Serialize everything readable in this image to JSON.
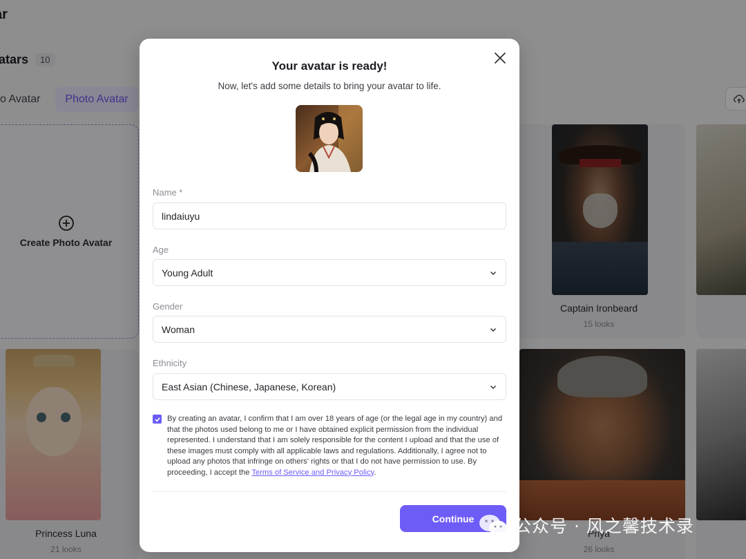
{
  "background": {
    "page_title": "ar",
    "section_heading": "vatars",
    "avatar_count": "10",
    "tabs": [
      {
        "label": "o Avatar",
        "active": false
      },
      {
        "label": "Photo Avatar",
        "active": true
      }
    ],
    "create_card_label": "Create Photo Avatar",
    "cards": [
      {
        "name": "Captain Ironbeard",
        "looks": "15 looks"
      },
      {
        "name": "Princess Luna",
        "looks": "21 looks"
      },
      {
        "name": "Priya",
        "looks": "26 looks"
      }
    ]
  },
  "modal": {
    "title": "Your avatar is ready!",
    "subtitle": "Now, let's add some details to bring your avatar to life.",
    "fields": {
      "name": {
        "label": "Name *",
        "value": "lindaiuyu"
      },
      "age": {
        "label": "Age",
        "value": "Young Adult"
      },
      "gender": {
        "label": "Gender",
        "value": "Woman"
      },
      "ethnicity": {
        "label": "Ethnicity",
        "value": "East Asian (Chinese, Japanese, Korean)"
      }
    },
    "consent": {
      "checked": true,
      "text": "By creating an avatar, I confirm that I am over 18 years of age (or the legal age in my country) and that the photos used belong to me or I have obtained explicit permission from the individual represented. I understand that I am solely responsible for the content I upload and that the use of these images must comply with all applicable laws and regulations. Additionally, I agree not to upload any photos that infringe on others' rights or that I do not have permission to use. By proceeding, I accept the ",
      "link": "Terms of Service and Privacy Policy",
      "suffix": "."
    },
    "continue_label": "Continue"
  },
  "watermark": "公众号 · 风之馨技术录",
  "colors": {
    "accent": "#6d5cf6",
    "overlay": "rgba(0,0,0,0.42)"
  }
}
